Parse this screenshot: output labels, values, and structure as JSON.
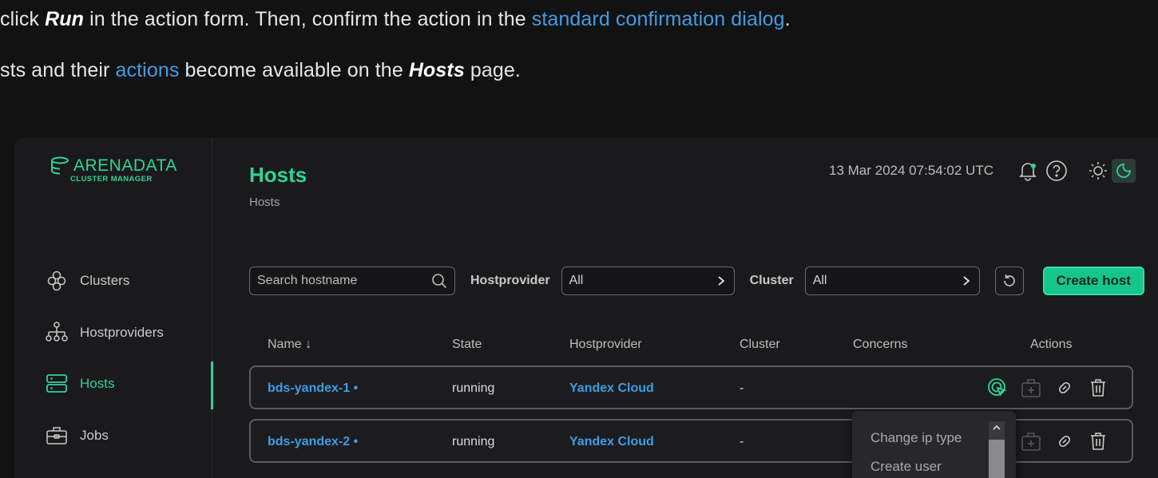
{
  "doc": {
    "line1": {
      "pre": "click ",
      "bold": "Run",
      "mid": " in the action form. Then, confirm the action in the ",
      "link": "standard confirmation dialog",
      "post": "."
    },
    "line2": {
      "pre": "sts and their ",
      "link": "actions",
      "mid": " become available on the ",
      "bold": "Hosts",
      "post": " page."
    }
  },
  "logo": {
    "word": "ARENADATA",
    "sub": "CLUSTER MANAGER"
  },
  "sidebar": {
    "items": [
      {
        "label": "Clusters",
        "icon": "clusters-icon"
      },
      {
        "label": "Hostproviders",
        "icon": "hostproviders-icon"
      },
      {
        "label": "Hosts",
        "icon": "hosts-icon",
        "active": true
      },
      {
        "label": "Jobs",
        "icon": "jobs-icon"
      }
    ]
  },
  "header": {
    "title": "Hosts",
    "breadcrumb": "Hosts",
    "datetime": "13 Mar 2024  07:54:02  UTC"
  },
  "filters": {
    "search_placeholder": "Search hostname",
    "hostprovider_label": "Hostprovider",
    "hostprovider_value": "All",
    "cluster_label": "Cluster",
    "cluster_value": "All",
    "create_label": "Create host"
  },
  "table": {
    "columns": [
      "Name ↓",
      "State",
      "Hostprovider",
      "Cluster",
      "Concerns",
      "Actions"
    ],
    "rows": [
      {
        "name": "bds-yandex-1 •",
        "state": "running",
        "hostprovider": "Yandex Cloud",
        "cluster": "-"
      },
      {
        "name": "bds-yandex-2 •",
        "state": "running",
        "hostprovider": "Yandex Cloud",
        "cluster": "-"
      }
    ]
  },
  "action_menu": {
    "items": [
      "Change ip type",
      "Create user"
    ]
  },
  "colors": {
    "accent": "#2fd29a",
    "link": "#3f9de4",
    "background": "#1a1a1c"
  }
}
